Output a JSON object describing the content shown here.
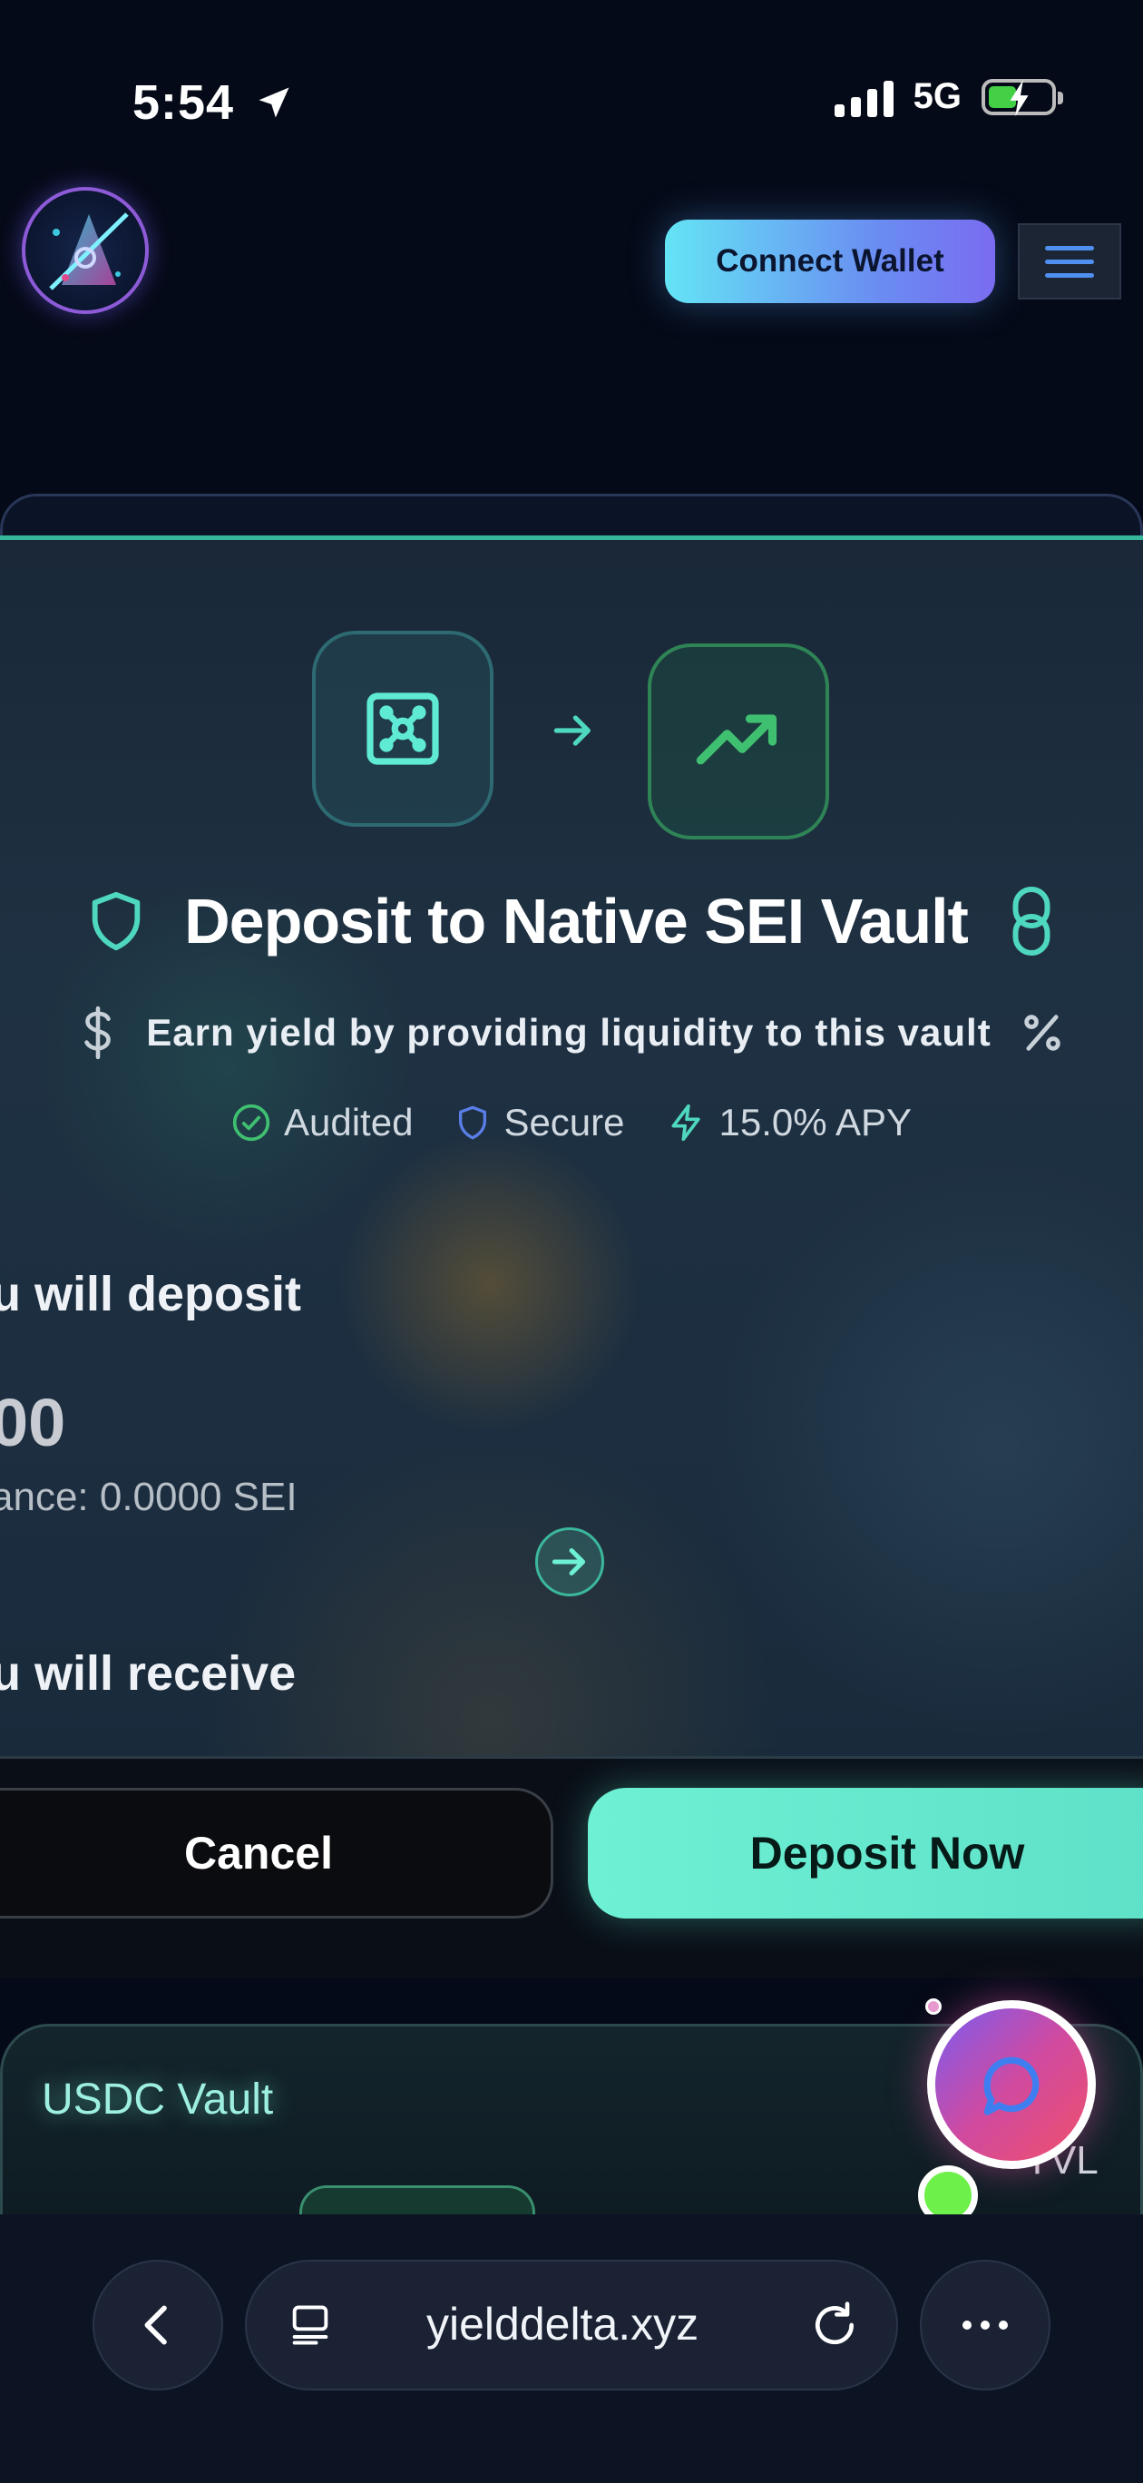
{
  "status_bar": {
    "time": "5:54",
    "network": "5G"
  },
  "header": {
    "connect_label": "Connect Wallet"
  },
  "modal": {
    "title": "Deposit to Native SEI Vault",
    "subtitle": "Earn yield by providing liquidity to this vault",
    "badges": [
      {
        "label": "Audited",
        "icon": "check-circle-icon"
      },
      {
        "label": "Secure",
        "icon": "shield-icon"
      },
      {
        "label": "15.0% APY",
        "icon": "lightning-icon"
      }
    ],
    "deposit_label": "u will deposit",
    "amount_display": "00",
    "balance_text": "ance: 0.0000 SEI",
    "receive_label": "u will receive",
    "cancel_label": "Cancel",
    "deposit_label_btn": "Deposit Now",
    "colors": {
      "accent": "#6ef0d4",
      "shield": "#4fd8c0",
      "trend": "#3fc070"
    }
  },
  "usdc_card": {
    "title": "USDC Vault",
    "tvl_label": "TVL"
  },
  "browser": {
    "url": "yielddelta.xyz"
  }
}
